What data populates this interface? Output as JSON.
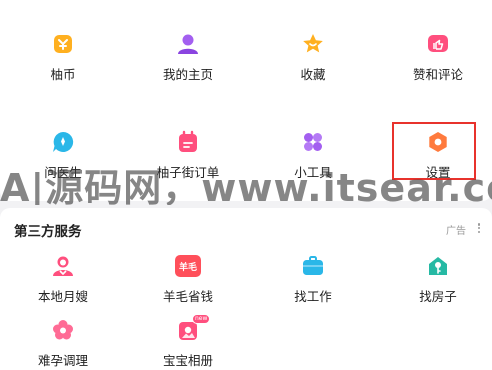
{
  "grid_top": [
    {
      "label": "柚币",
      "icon": "coin-icon"
    },
    {
      "label": "我的主页",
      "icon": "user-icon"
    },
    {
      "label": "收藏",
      "icon": "star-icon"
    },
    {
      "label": "赞和评论",
      "icon": "thumbs-up-icon"
    },
    {
      "label": "问医生",
      "icon": "chat-doctor-icon"
    },
    {
      "label": "柚子街订单",
      "icon": "order-bag-icon"
    },
    {
      "label": "小工具",
      "icon": "tools-icon"
    },
    {
      "label": "设置",
      "icon": "settings-icon"
    }
  ],
  "third_party": {
    "title": "第三方服务",
    "ad_label": "广告",
    "items": [
      {
        "label": "本地月嫂",
        "icon": "nanny-icon"
      },
      {
        "label": "羊毛省钱",
        "icon": "save-money-icon",
        "icon_text": "羊毛"
      },
      {
        "label": "找工作",
        "icon": "briefcase-icon"
      },
      {
        "label": "找房子",
        "icon": "house-icon"
      },
      {
        "label": "难孕调理",
        "icon": "flower-icon"
      },
      {
        "label": "宝宝相册",
        "icon": "photo-album-icon",
        "badge_text": "new"
      }
    ]
  },
  "watermark": "A|源码网，www.itsear.co",
  "colors": {
    "highlight": "#e8322c",
    "orange": "#ffa51f",
    "purple": "#a35ff0",
    "pink": "#ff4f7e",
    "cyan": "#2ab7e8",
    "teal": "#26b9a4"
  }
}
